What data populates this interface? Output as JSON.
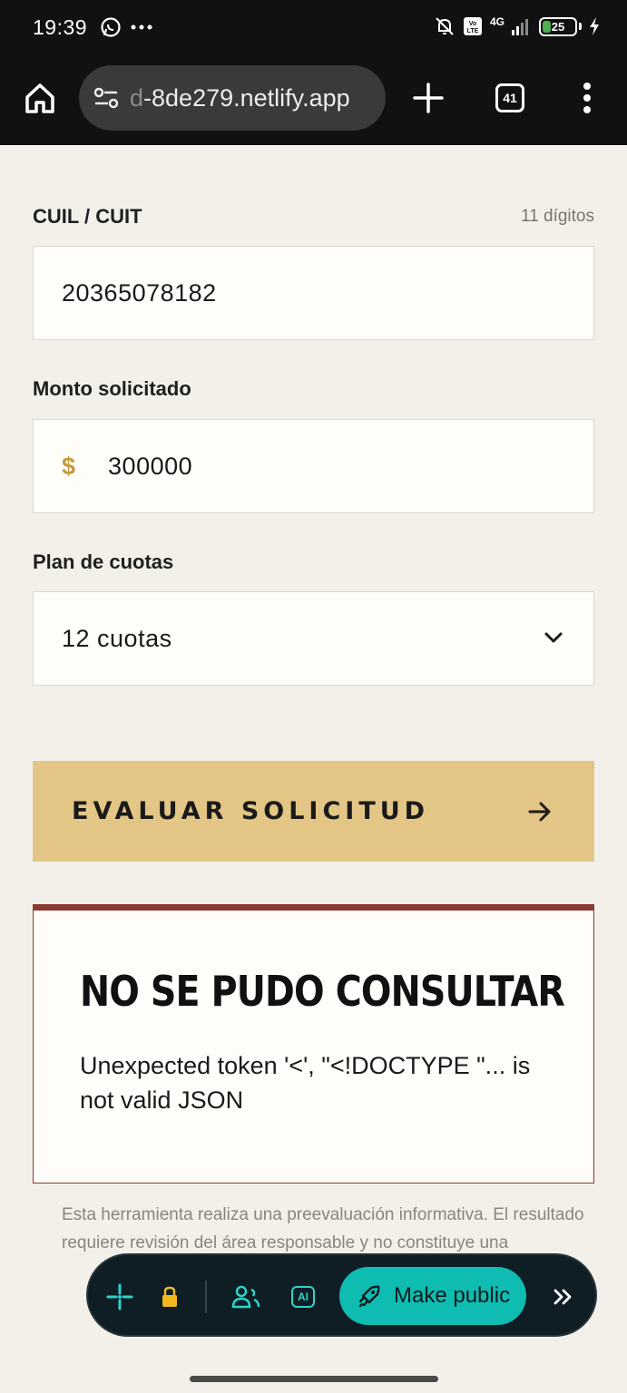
{
  "status_bar": {
    "time": "19:39",
    "network": "4G",
    "volte": "Vo LTE",
    "battery_level": "25",
    "battery_percent": 25
  },
  "browser": {
    "url_faded": "d",
    "url": "-8de279.netlify.app",
    "tab_count": "41"
  },
  "form": {
    "cuil": {
      "label": "CUIL / CUIT",
      "hint": "11 dígitos",
      "value": "20365078182"
    },
    "monto": {
      "label": "Monto solicitado",
      "currency": "$",
      "value": "300000"
    },
    "plan": {
      "label": "Plan de cuotas",
      "selected": "12 cuotas"
    },
    "submit_label": "EVALUAR SOLICITUD"
  },
  "error": {
    "title": "NO SE PUDO CONSULTAR",
    "message": "Unexpected token '<', \"<!DOCTYPE \"... is not valid JSON"
  },
  "disclaimer": "Esta herramienta realiza una preevaluación informativa. El resultado requiere revisión del área responsable y no constituye una",
  "floating_toolbar": {
    "ai_label": "AI",
    "make_public_label": "Make public"
  },
  "colors": {
    "accent_gold": "#e3c685",
    "error_border": "#8a3a33",
    "teal": "#0fbcb2",
    "background": "#f3f0ea"
  }
}
